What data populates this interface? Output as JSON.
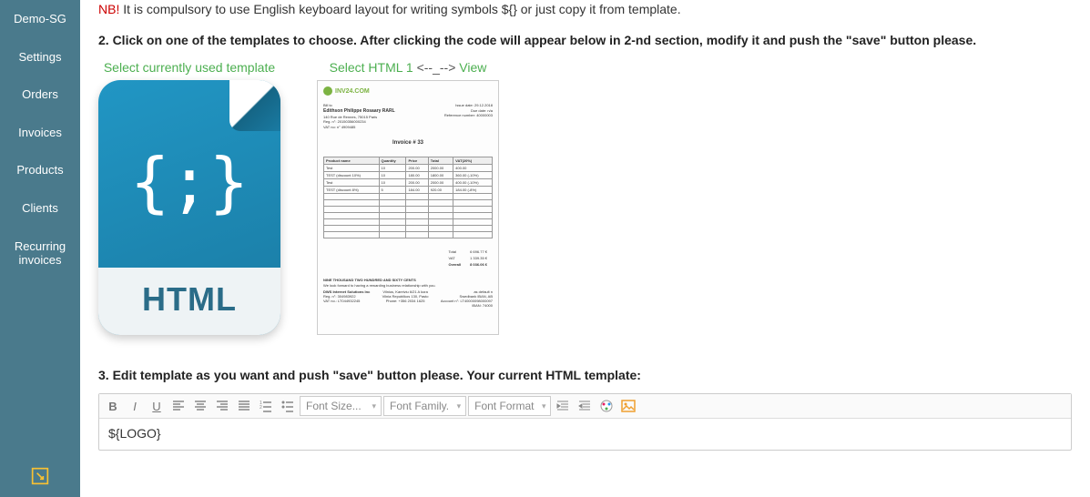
{
  "sidebar": {
    "items": [
      {
        "label": "Demo-SG"
      },
      {
        "label": "Settings"
      },
      {
        "label": "Orders"
      },
      {
        "label": "Invoices"
      },
      {
        "label": "Products"
      },
      {
        "label": "Clients"
      },
      {
        "label": "Recurring invoices"
      }
    ]
  },
  "nb": {
    "prefix": "NB!",
    "text": " It is compulsory to use English keyboard layout for writing symbols ${} or just copy it from template."
  },
  "step2_title": "2. Click on one of the templates to choose. After clicking the code will appear below in 2-nd section, modify it and push the \"save\" button please.",
  "templates": {
    "current_label": "Select currently used template",
    "html1_prefix": "Select HTML 1 ",
    "html1_arrow": "<--_-->",
    "html1_suffix": " View",
    "html_badge": "HTML",
    "braces": "{;}"
  },
  "invoice_preview": {
    "logo_text": "INV24.COM",
    "bill_to_label": "Bill to",
    "customer_name": "Edithson Philippe Rosaary RARL",
    "address1": "140 Rue de Rennes, 75015 Paris",
    "reg": "Reg. n°: 20150356000234",
    "vat": "VAT no: n° 4909485",
    "issue_date": "Issue date: 29.12.2018",
    "due_date": "Due date: n/a",
    "ref": "Reference number: 40000003",
    "title": "Invoice # 33",
    "columns": [
      "Product name",
      "Quantity",
      "Price",
      "Total",
      "VAT(20%)"
    ],
    "rows": [
      [
        "Test",
        "10",
        "200.00",
        "2000.00",
        "400.00"
      ],
      [
        "TEST (discount 10%)",
        "10",
        "180.00",
        "1800.00",
        "360.00 (-10%)"
      ],
      [
        "Test",
        "10",
        "200.00",
        "2000.00",
        "400.00 (-10%)"
      ],
      [
        "TEST (discount 8%)",
        "5",
        "184.00",
        "920.00",
        "184.00 (-8%)"
      ]
    ],
    "totals": {
      "subtotal_label": "Total",
      "subtotal": "6 696.77 €",
      "vat_label": "VAT",
      "vat": "1 339.35 €",
      "overall_label": "Overall",
      "overall": "8 036.06 €"
    },
    "amount_words": "NINE THOUSAND TWO HUNDRED AND SIXTY CENTS",
    "footer_note": "We look forward to having a rewarding business relationship with you.",
    "company": "DWS Internet Solutions Inc",
    "company_reg": "Reg. n°: 304983922",
    "company_vat": "VAT no.: LT044932245",
    "company_addr1": "Vilnius, Kareiviu 6/21 A kora",
    "company_addr2": "Vilnia Republikos 130, Pasto",
    "company_phone": "Phone: +356 2034 1625",
    "bank_label": "as default n",
    "bank1": "Swedbank IBAN, AB",
    "bank2": "Account n°: LT40000098000097",
    "bank3": "IBAN: 74000"
  },
  "step3_title": "3. Edit template as you want and push \"save\" button please. Your current HTML template:",
  "toolbar": {
    "font_size": "Font Size...",
    "font_family": "Font Family.",
    "font_format": "Font Format"
  },
  "editor_content": "${LOGO}"
}
